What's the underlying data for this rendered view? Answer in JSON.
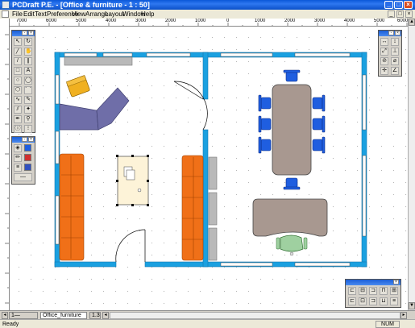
{
  "window": {
    "title": "PCDraft P.E. - [Office & furniture - 1 : 50]",
    "minimize": "_",
    "maximize": "□",
    "close": "×"
  },
  "menu": {
    "items": [
      "File",
      "Edit",
      "Text",
      "Preference",
      "View",
      "Arrange",
      "Layout",
      "Window",
      "Help"
    ]
  },
  "ruler": {
    "top_labels": [
      "7000",
      "6000",
      "5000",
      "4000",
      "3000",
      "2000",
      "1000",
      "0",
      "1000",
      "2000",
      "3000",
      "4000",
      "5000",
      "6000"
    ]
  },
  "bottom_bar": {
    "layer_name": "Office_furniture",
    "zoom": "1.3x"
  },
  "status": {
    "text": "Ready",
    "num": "NUM"
  },
  "icons": {
    "arrow": "arrow-icon",
    "rotate": "rotate-icon",
    "line": "line-icon",
    "text": "text-tool-icon"
  },
  "colors": {
    "wall": "#1aa0e0",
    "desk": "#a89890",
    "chair_blue": "#1f5ee0",
    "sofa_purple": "#6f6ea8",
    "sofa_orange": "#f07018",
    "armchair": "#f0b020",
    "table_top": "#fdf3d8",
    "green_chair": "#9fd0a0"
  }
}
